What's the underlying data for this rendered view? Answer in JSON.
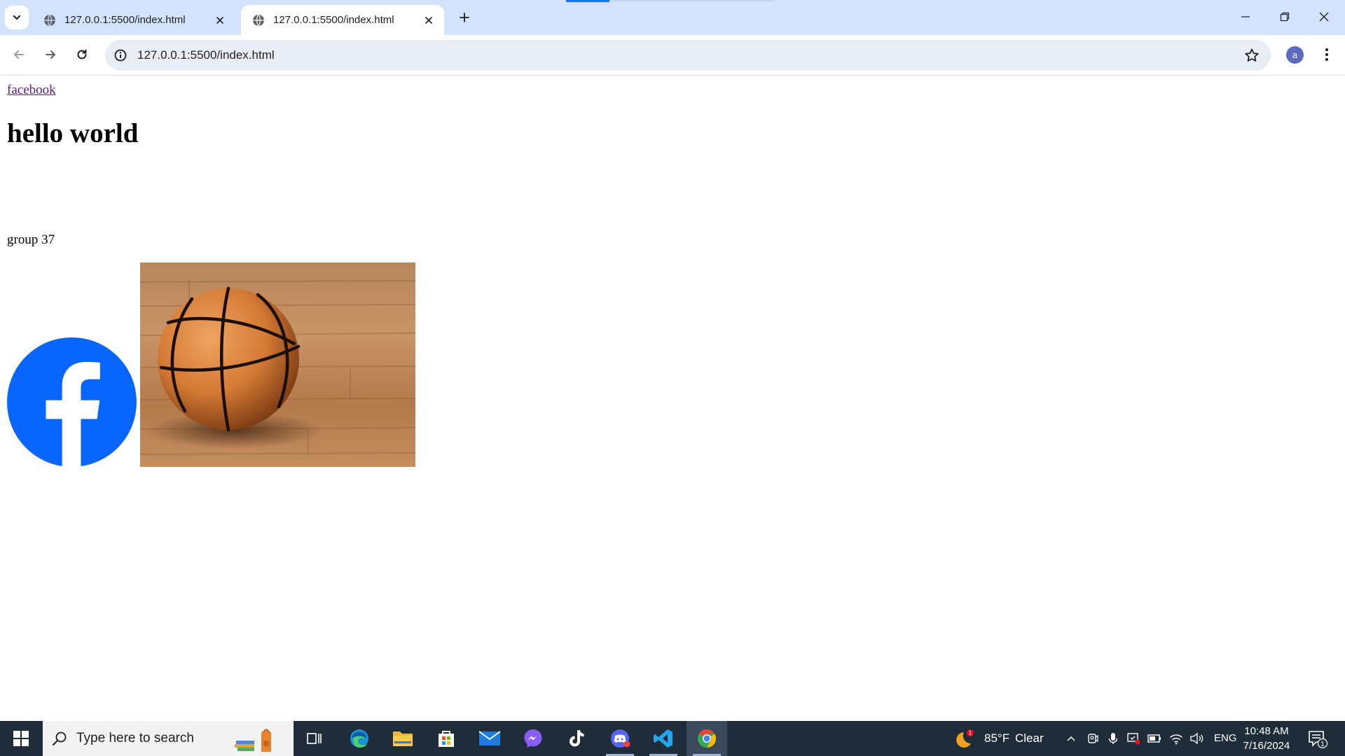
{
  "browser": {
    "tabs": [
      {
        "title": "127.0.0.1:5500/index.html",
        "active": false
      },
      {
        "title": "127.0.0.1:5500/index.html",
        "active": true
      }
    ],
    "url": "127.0.0.1:5500/index.html",
    "profile_initial": "a",
    "icons": {
      "tab_search": "chevron-down-icon",
      "tab_favicon": "globe-icon",
      "tab_close": "close-icon",
      "new_tab": "plus-icon",
      "minimize": "minimize-icon",
      "restore": "restore-icon",
      "close_window": "close-icon",
      "back": "arrow-left-icon",
      "forward": "arrow-right-icon",
      "reload": "reload-icon",
      "site_info": "info-icon",
      "bookmark": "star-icon",
      "menu": "kebab-menu-icon"
    }
  },
  "page": {
    "link_text": "facebook",
    "heading": "hello world",
    "group_text": "group 37",
    "images": [
      "facebook-logo",
      "basketball-photo"
    ],
    "colors": {
      "link": "#551a8b",
      "facebook_blue": "#0866ff"
    }
  },
  "taskbar": {
    "search_placeholder": "Type here to search",
    "apps": [
      "task-view",
      "edge",
      "file-explorer",
      "microsoft-store",
      "mail",
      "messenger",
      "tiktok",
      "discord",
      "vs-code",
      "chrome"
    ],
    "active_app": "chrome",
    "weather": {
      "temp": "85°F",
      "condition": "Clear",
      "badge": "1"
    },
    "language": "ENG",
    "time": "10:48 AM",
    "date": "7/16/2024",
    "notification_count": "1"
  }
}
